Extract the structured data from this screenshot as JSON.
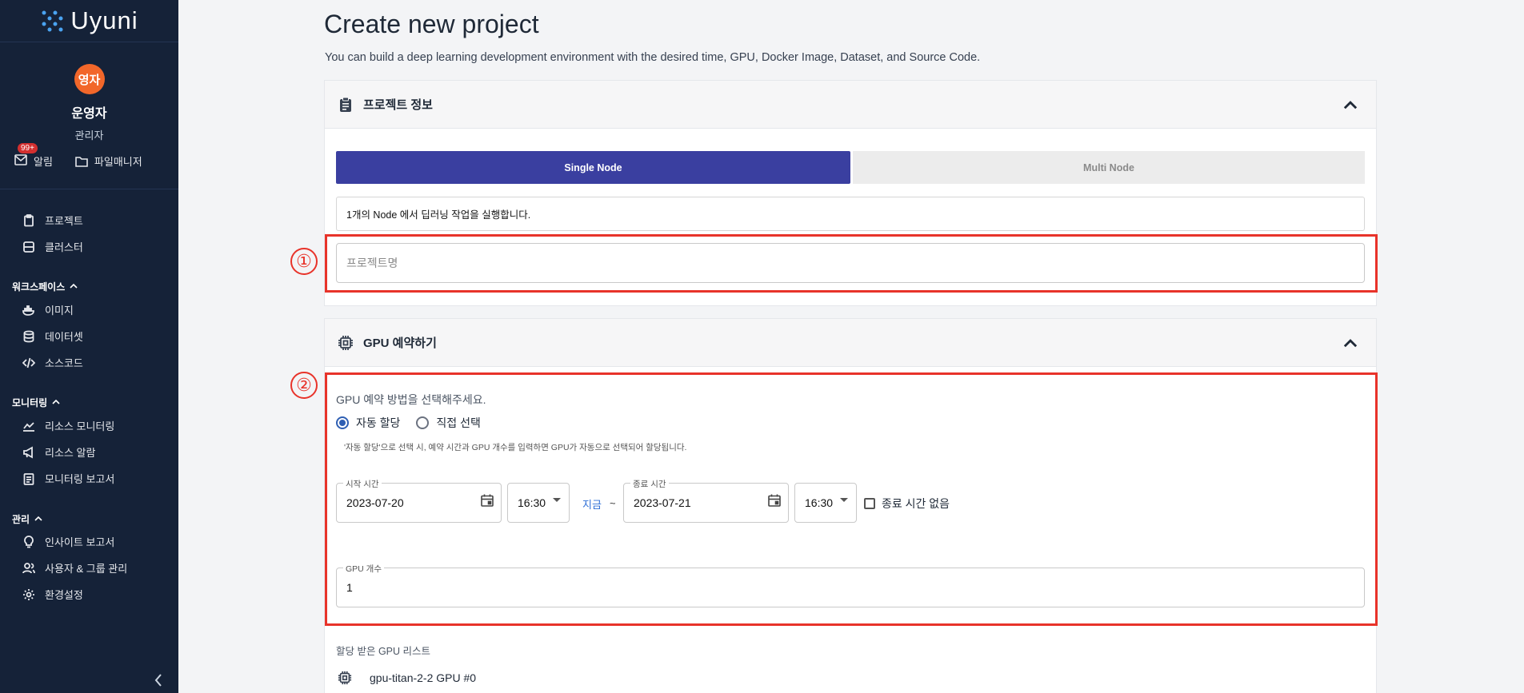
{
  "app": {
    "name": "Uyuni"
  },
  "profile": {
    "avatar_text": "영자",
    "name": "운영자",
    "role": "관리자"
  },
  "quick_links": {
    "notifications_label": "알림",
    "notifications_badge": "99+",
    "file_manager_label": "파일매니저"
  },
  "nav": {
    "top": [
      {
        "label": "프로젝트",
        "icon": "clipboard-icon"
      },
      {
        "label": "클러스터",
        "icon": "server-icon"
      }
    ],
    "workspace": {
      "label": "워크스페이스",
      "items": [
        {
          "label": "이미지",
          "icon": "docker-icon"
        },
        {
          "label": "데이터셋",
          "icon": "database-icon"
        },
        {
          "label": "소스코드",
          "icon": "code-icon"
        }
      ]
    },
    "monitoring": {
      "label": "모니터링",
      "items": [
        {
          "label": "리소스 모니터링",
          "icon": "chart-line-icon"
        },
        {
          "label": "리소스 알람",
          "icon": "megaphone-icon"
        },
        {
          "label": "모니터링 보고서",
          "icon": "report-icon"
        }
      ]
    },
    "admin": {
      "label": "관리",
      "items": [
        {
          "label": "인사이트 보고서",
          "icon": "lightbulb-icon"
        },
        {
          "label": "사용자 & 그룹 관리",
          "icon": "users-icon"
        },
        {
          "label": "환경설정",
          "icon": "gear-icon"
        }
      ]
    }
  },
  "page": {
    "title": "Create new project",
    "subtitle": "You can build a deep learning development environment with the desired time, GPU, Docker Image, Dataset, and Source Code."
  },
  "project_info": {
    "header": "프로젝트 정보",
    "tabs": {
      "single": "Single Node",
      "multi": "Multi Node",
      "selected": "Single Node"
    },
    "description": "1개의 Node 에서 딥러닝 작업을 실행합니다.",
    "name_placeholder": "프로젝트명",
    "name_value": ""
  },
  "gpu_reservation": {
    "header": "GPU 예약하기",
    "method_label": "GPU 예약 방법을 선택해주세요.",
    "options": [
      "자동 할당",
      "직접 선택"
    ],
    "selected_option": "자동 할당",
    "hint": "'자동 할당'으로 선택 시, 예약 시간과 GPU 개수를 입력하면 GPU가 자동으로 선택되어 할당됩니다.",
    "start": {
      "label": "시작 시간",
      "date": "2023-07-20",
      "time": "16:30"
    },
    "now_link": "지금",
    "separator": "~",
    "end": {
      "label": "종료 시간",
      "date": "2023-07-21",
      "time": "16:30"
    },
    "no_end_time_label": "종료 시간 없음",
    "no_end_time_checked": false,
    "gpu_count": {
      "label": "GPU 개수",
      "value": "1"
    },
    "assigned_list_label": "할당 받은 GPU 리스트",
    "assigned_gpus": [
      "gpu-titan-2-2 GPU #0"
    ]
  },
  "annotations": {
    "marker_1": "①",
    "marker_2": "②"
  },
  "colors": {
    "sidebar_bg": "#152238",
    "accent": "#3a3fa0",
    "annotation_red": "#e8332a",
    "avatar": "#f2672a"
  }
}
